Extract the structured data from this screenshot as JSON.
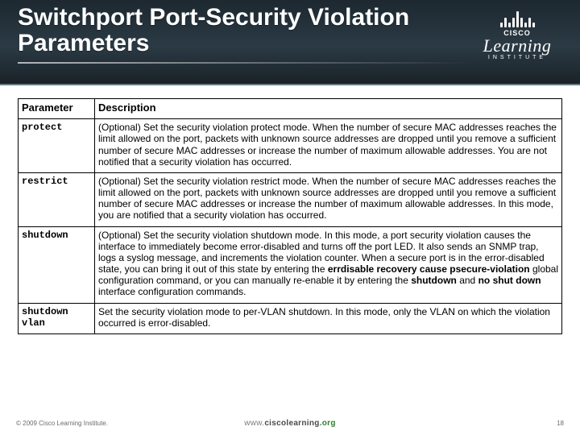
{
  "header": {
    "title": "Switchport Port-Security Violation Parameters"
  },
  "logo": {
    "brand": "CISCO",
    "line1": "Learning",
    "line2": "INSTITUTE"
  },
  "table": {
    "headers": {
      "param": "Parameter",
      "desc": "Description"
    },
    "rows": [
      {
        "param": "protect",
        "desc": "(Optional) Set the security violation protect mode. When the number of secure MAC addresses reaches the limit allowed on the port, packets with unknown source addresses are dropped until you remove a sufficient number of secure MAC addresses or increase the number of maximum allowable addresses. You are not notified that a security violation has occurred."
      },
      {
        "param": "restrict",
        "desc": "(Optional) Set the security violation restrict mode. When the number of secure MAC addresses reaches the limit allowed on the port, packets with unknown source addresses are dropped until you remove a sufficient number of secure MAC addresses or increase the number of maximum allowable addresses. In this mode, you are notified that a security violation has occurred."
      },
      {
        "param": "shutdown",
        "desc_parts": {
          "p1": "(Optional) Set the security violation shutdown mode. In this mode, a port security violation causes the interface to immediately become error-disabled and turns off the port LED. It also sends an SNMP trap, logs a syslog message, and increments the violation counter. When a secure port is in the error-disabled state, you can bring it out of this state by entering the ",
          "b1": "errdisable recovery cause psecure-violation",
          "p2": " global configuration command, or you can manually re-enable it by entering the ",
          "b2": "shutdown",
          "p3": " and ",
          "b3": "no shut down",
          "p4": " interface configuration commands."
        }
      },
      {
        "param": "shutdown vlan",
        "desc": "Set the security violation mode to per-VLAN shutdown. In this mode, only the VLAN on which the violation occurred is error-disabled."
      }
    ]
  },
  "footer": {
    "copyright": "© 2009 Cisco Learning Institute.",
    "url_prefix": "www.",
    "url_main": "ciscolearning",
    "url_suffix": ".org",
    "page": "18"
  }
}
